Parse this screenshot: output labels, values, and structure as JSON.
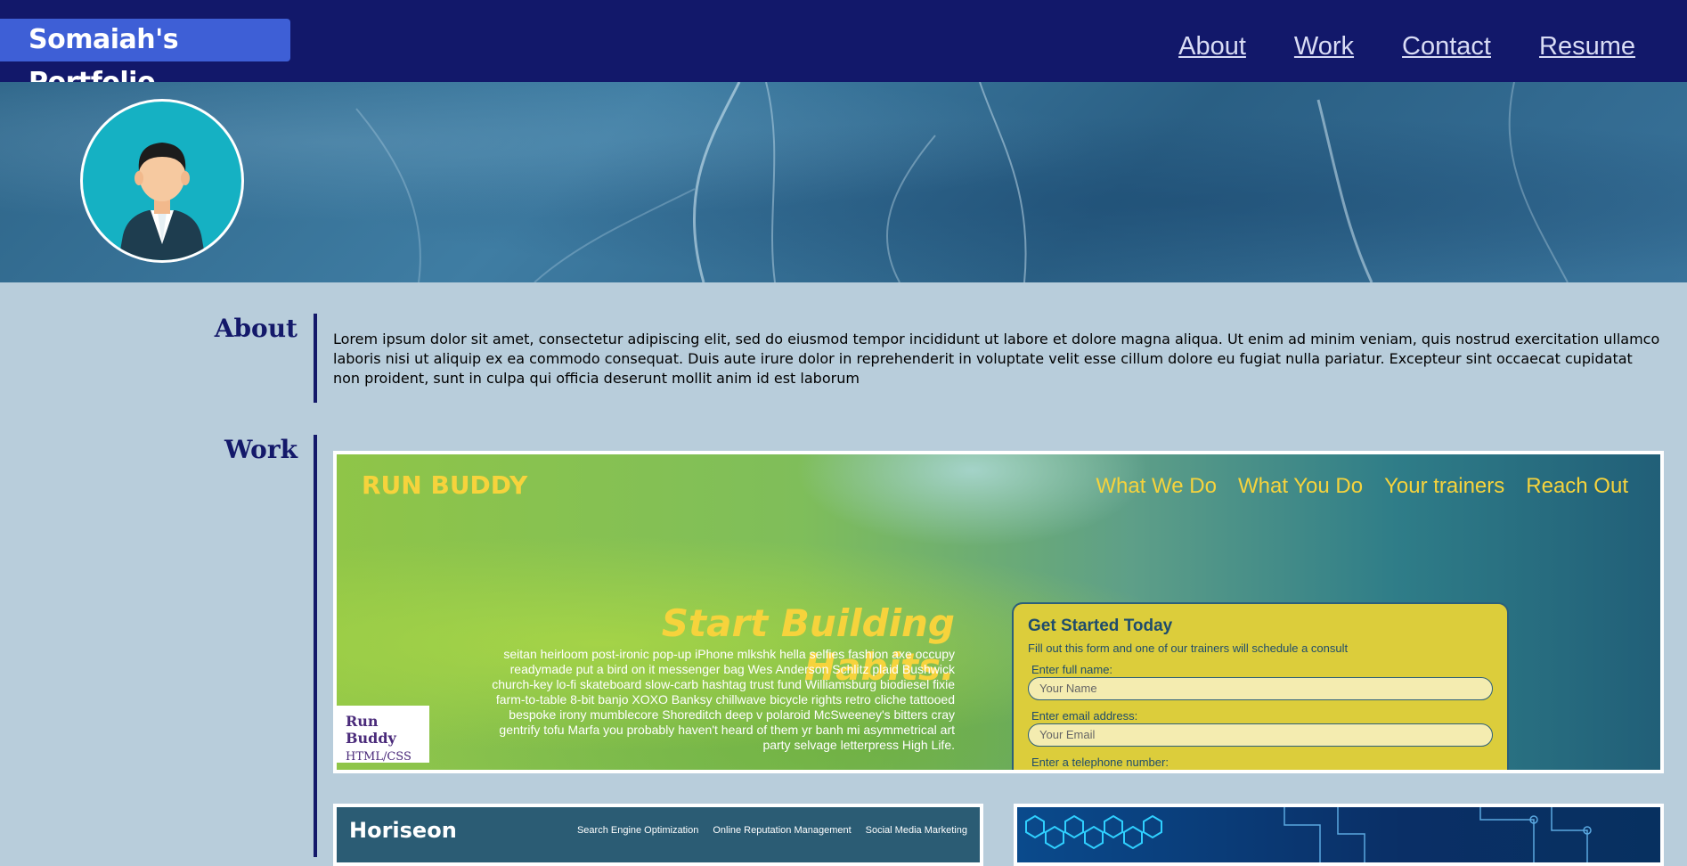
{
  "header": {
    "brand": "Somaiah's Portfolio",
    "nav": [
      "About",
      "Work",
      "Contact",
      "Resume"
    ]
  },
  "about": {
    "title": "About",
    "text": "Lorem ipsum dolor sit amet, consectetur adipiscing elit, sed do eiusmod tempor incididunt ut labore et dolore magna aliqua. Ut enim ad minim veniam, quis nostrud exercitation ullamco laboris nisi ut aliquip ex ea commodo consequat. Duis aute irure dolor in reprehenderit in voluptate velit esse cillum dolore eu fugiat nulla pariatur. Excepteur sint occaecat cupidatat non proident, sunt in culpa qui officia deserunt mollit anim id est laborum"
  },
  "work": {
    "title": "Work",
    "run_buddy": {
      "logo": "RUN BUDDY",
      "nav": [
        "What We Do",
        "What You Do",
        "Your trainers",
        "Reach Out"
      ],
      "headline": "Start Building Habits.",
      "body": "seitan heirloom post-ironic pop-up iPhone mlkshk hella selfies fashion axe occupy readymade put a bird on it messenger bag Wes Anderson Schlitz plaid Bushwick church-key lo-fi skateboard slow-carb hashtag trust fund Williamsburg biodiesel fixie farm-to-table 8-bit banjo XOXO Banksy chillwave bicycle rights retro cliche tattooed bespoke irony mumblecore Shoreditch deep v polaroid McSweeney's bitters cray gentrify tofu Marfa you probably haven't heard of them yr banh mi asymmetrical art party selvage letterpress High Life.",
      "form": {
        "title": "Get Started Today",
        "subtitle": "Fill out this form and one of our trainers will schedule a consult",
        "name_label": "Enter full name:",
        "name_placeholder": "Your Name",
        "email_label": "Enter email address:",
        "email_placeholder": "Your Email",
        "phone_label": "Enter a telephone number:"
      },
      "caption_title": "Run Buddy",
      "caption_sub": "HTML/CSS"
    },
    "horiseon": {
      "logo": "Horiseon",
      "nav": [
        "Search Engine Optimization",
        "Online Reputation Management",
        "Social Media Marketing"
      ]
    }
  },
  "colors": {
    "header_bg": "#12186a",
    "brand_bg": "#3e5fd6",
    "page_bg": "#b8cddb",
    "accent_yellow": "#f6d33c"
  }
}
